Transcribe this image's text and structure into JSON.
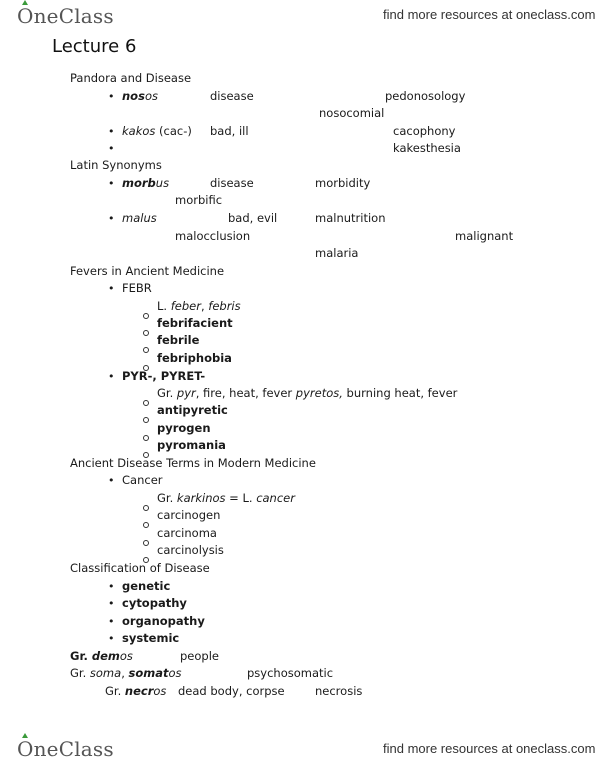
{
  "header": {
    "logo": "OneClass",
    "tagline": "find more resources at oneclass.com"
  },
  "footer": {
    "logo": "OneClass",
    "tagline": "find more resources at oneclass.com"
  },
  "doc": {
    "title": "Lecture 6",
    "s1": {
      "heading": "Pandora and Disease",
      "nosos_b": "nos",
      "nosos_i": "os",
      "nosos_def": "disease",
      "nosos_ex1": "pedonosology",
      "nosos_ex2": "nosocomial",
      "kakos_i": "kakos",
      "kakos_paren": " (cac-)",
      "kakos_def": "bad, ill",
      "kakos_ex1": "cacophony",
      "kakos_ex2": "kakesthesia"
    },
    "s2": {
      "heading": "Latin Synonyms",
      "morbus_b": "morb",
      "morbus_i": "us",
      "morbus_def": "disease",
      "morbus_ex1": "morbidity",
      "morbus_ex2": "morbific",
      "malus_i": "malus",
      "malus_def": "bad, evil",
      "malus_ex1": "malnutrition",
      "malus_ex2": "malocclusion",
      "malus_ex3": "malignant",
      "malus_ex4": "malaria"
    },
    "s3": {
      "heading": "Fevers in Ancient Medicine",
      "febr": "FEBR",
      "febr_l": "L. ",
      "febr_latin": "feber",
      "febr_comma": ", ",
      "febr_latin2": "febris",
      "febr_items": [
        "febrifacient",
        "febrile",
        "febriphobia"
      ],
      "pyr": "PYR-, PYRET-",
      "pyr_gr": "Gr. ",
      "pyr_word": "pyr",
      "pyr_def": ", fire, heat, fever ",
      "pyretos": "pyretos,",
      "pyretos_def": " burning heat, fever",
      "pyr_items": [
        "antipyretic",
        "pyrogen",
        "pyromania"
      ]
    },
    "s4": {
      "heading": "Ancient Disease Terms in Modern Medicine",
      "cancer": "Cancer",
      "gr": "Gr. ",
      "karkinos": "karkinos",
      "eq": " =  L. ",
      "cancer_l": "cancer",
      "items": [
        "carcinogen",
        "carcinoma",
        "carcinolysis"
      ]
    },
    "s5": {
      "heading": "Classification of Disease",
      "items": [
        "genetic",
        "cytopathy",
        "organopathy",
        "systemic"
      ]
    },
    "demos": {
      "gr": "Gr. ",
      "b": "dem",
      "i": "os",
      "def": "people"
    },
    "soma": {
      "gr": "Gr. ",
      "soma": "soma",
      "comma": ", ",
      "somat_b": "somat",
      "somat_i": "os",
      "ex": "psychosomatic"
    },
    "necros": {
      "gr": "Gr. ",
      "b": "necr",
      "i": "os",
      "def": "dead body, corpse",
      "ex": "necrosis"
    }
  }
}
